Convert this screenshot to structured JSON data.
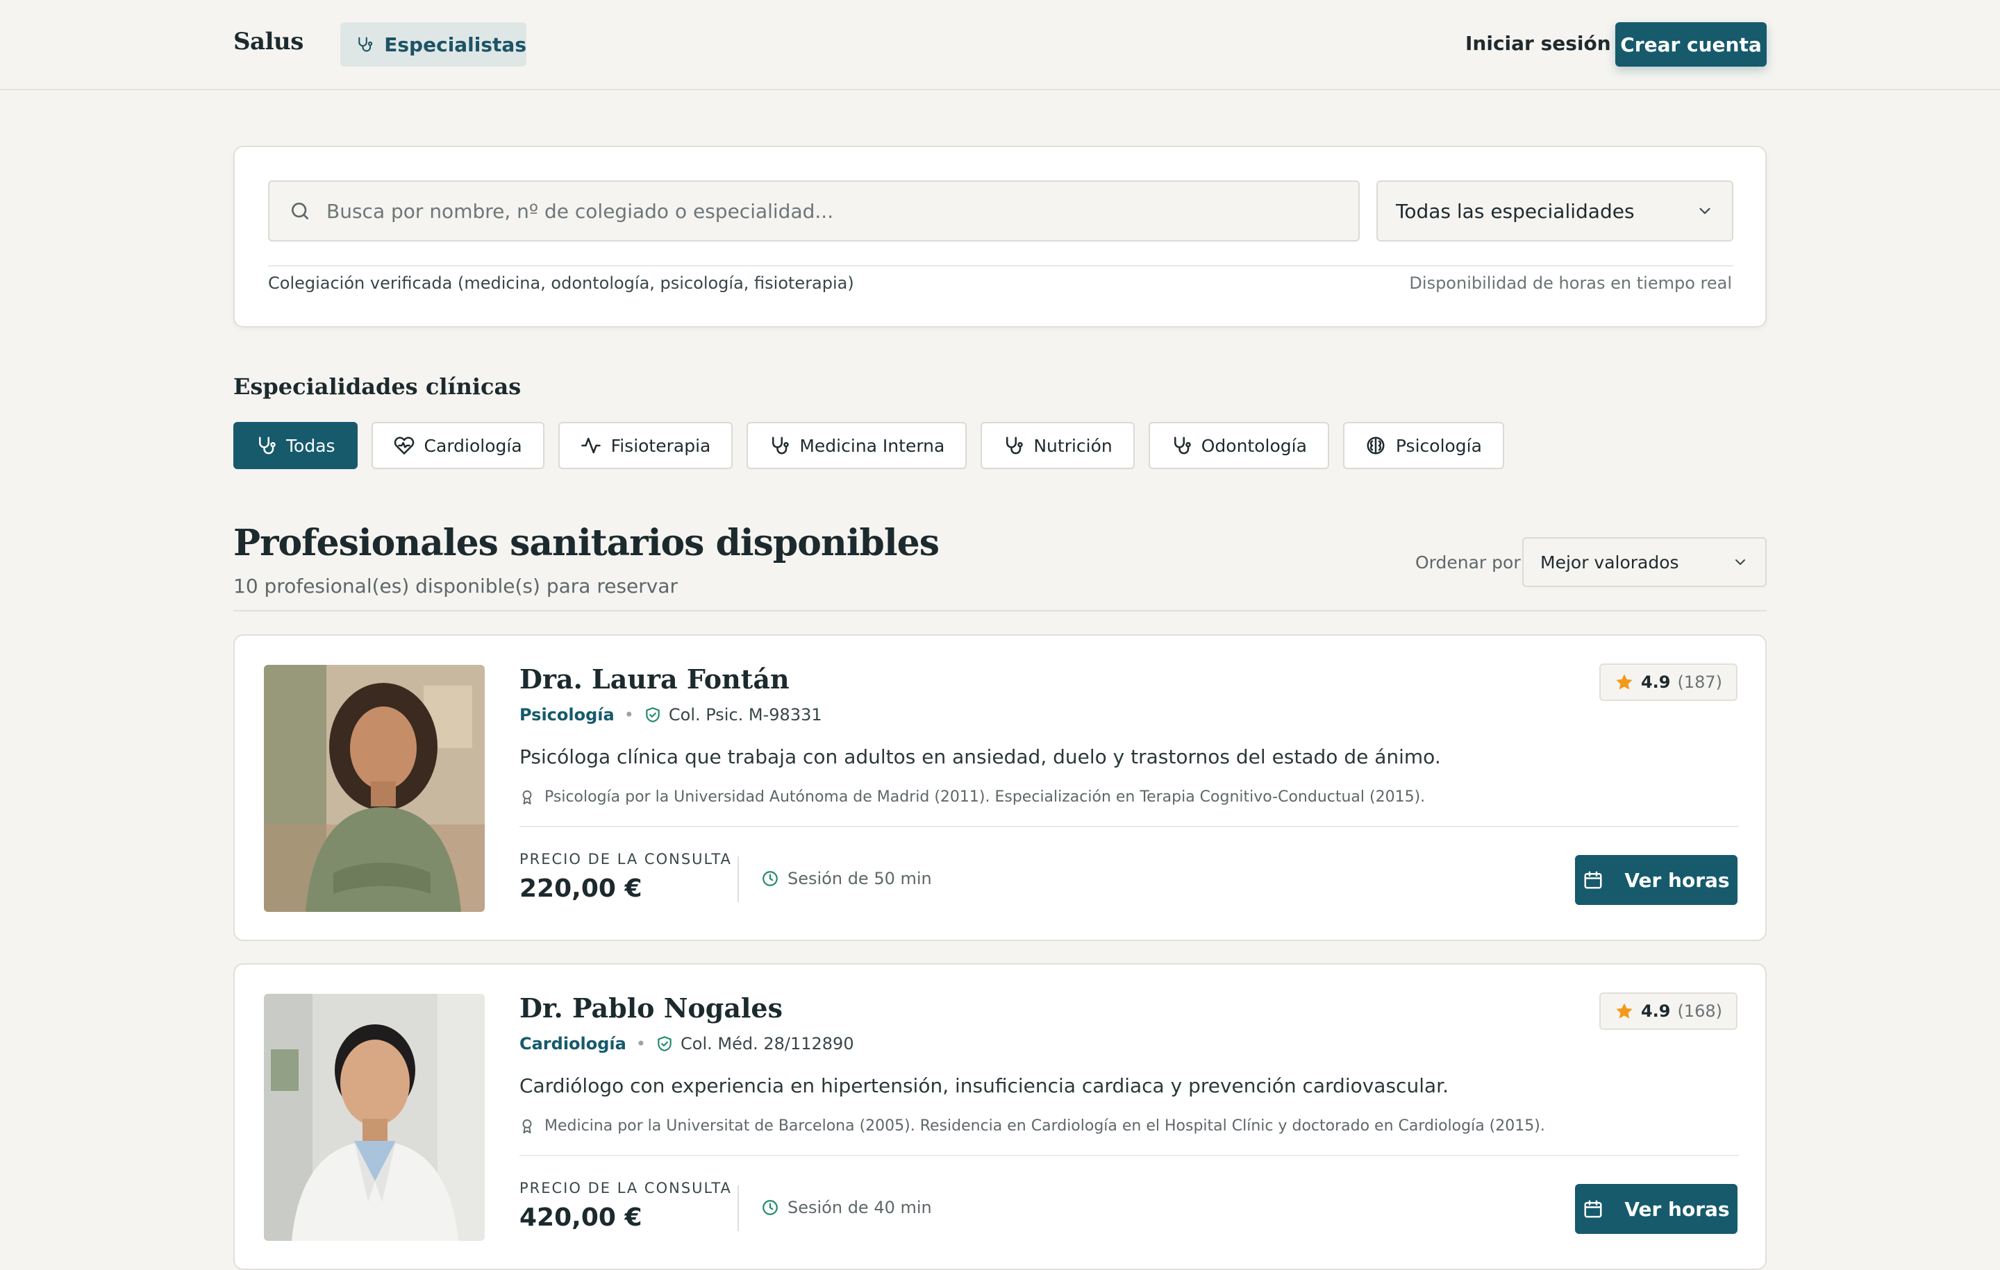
{
  "header": {
    "brand": "Salus",
    "nav_active": "Especialistas",
    "login": "Iniciar sesión",
    "signup": "Crear cuenta"
  },
  "search": {
    "placeholder": "Busca por nombre, nº de colegiado o especialidad...",
    "specialty_select": "Todas las especialidades",
    "verification_note": "Colegiación verificada (medicina, odontología, psicología, fisioterapia)",
    "availability_note": "Disponibilidad de horas en tiempo real"
  },
  "specialties": {
    "heading": "Especialidades clínicas",
    "chips": [
      {
        "label": "Todas",
        "icon": "stethoscope-icon",
        "active": true
      },
      {
        "label": "Cardiología",
        "icon": "heart-icon",
        "active": false
      },
      {
        "label": "Fisioterapia",
        "icon": "activity-icon",
        "active": false
      },
      {
        "label": "Medicina Interna",
        "icon": "stethoscope-icon",
        "active": false
      },
      {
        "label": "Nutrición",
        "icon": "stethoscope-icon",
        "active": false
      },
      {
        "label": "Odontología",
        "icon": "stethoscope-icon",
        "active": false
      },
      {
        "label": "Psicología",
        "icon": "brain-icon",
        "active": false
      }
    ]
  },
  "results": {
    "title": "Profesionales sanitarios disponibles",
    "subtitle": "10 profesional(es) disponible(s) para reservar",
    "sort_label": "Ordenar por:",
    "sort_value": "Mejor valorados"
  },
  "doctors": [
    {
      "name": "Dra. Laura Fontán",
      "specialty": "Psicología",
      "license": "Col. Psic. M-98331",
      "rating": "4.9",
      "reviews": "(187)",
      "bio": "Psicóloga clínica que trabaja con adultos en ansiedad, duelo y trastornos del estado de ánimo.",
      "education": "Psicología por la Universidad Autónoma de Madrid (2011). Especialización en Terapia Cognitivo-Conductual (2015).",
      "price_label": "PRECIO DE LA CONSULTA",
      "price": "220,00 €",
      "session": "Sesión de 50 min",
      "cta": "Ver horas"
    },
    {
      "name": "Dr. Pablo Nogales",
      "specialty": "Cardiología",
      "license": "Col. Méd. 28/112890",
      "rating": "4.9",
      "reviews": "(168)",
      "bio": "Cardiólogo con experiencia en hipertensión, insuficiencia cardiaca y prevención cardiovascular.",
      "education": "Medicina por la Universitat de Barcelona (2005). Residencia en Cardiología en el Hospital Clínic y doctorado en Cardiología (2015).",
      "price_label": "PRECIO DE LA CONSULTA",
      "price": "420,00 €",
      "session": "Sesión de 40 min",
      "cta": "Ver horas"
    }
  ],
  "colors": {
    "primary": "#165a6c",
    "background": "#f5f4f0",
    "star": "#f29a1c"
  }
}
